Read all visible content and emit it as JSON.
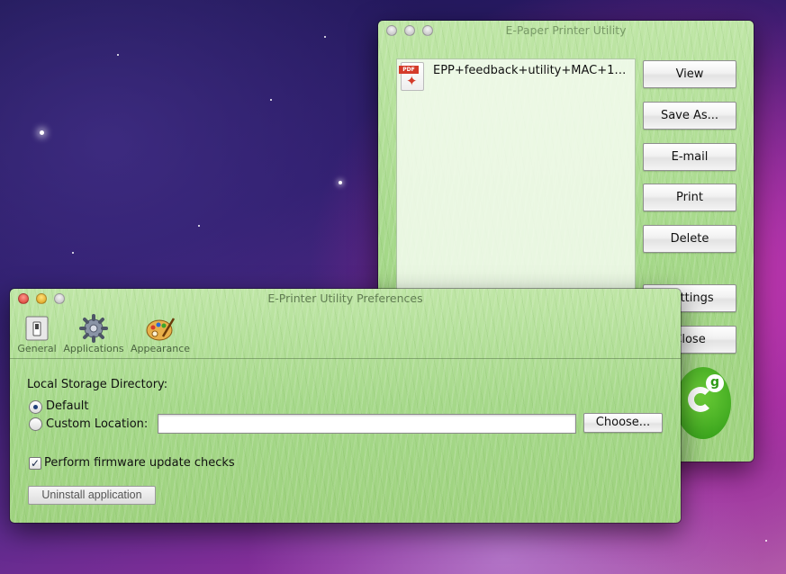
{
  "epp_window": {
    "title": "E-Paper Printer Utility",
    "files": [
      {
        "name": "EPP+feedback+utility+MAC+15...",
        "icon": "pdf-icon",
        "badge": "PDF"
      }
    ],
    "buttons": {
      "view": "View",
      "save_as": "Save As...",
      "email": "E-mail",
      "print": "Print",
      "delete": "Delete",
      "settings": "Settings",
      "close": "Close"
    },
    "logo_letter": "g"
  },
  "prefs_window": {
    "title": "E-Printer Utility Preferences",
    "toolbar": [
      {
        "label": "General",
        "icon": "switch-icon"
      },
      {
        "label": "Applications",
        "icon": "gear-icon"
      },
      {
        "label": "Appearance",
        "icon": "palette-icon"
      }
    ],
    "storage_label": "Local Storage Directory:",
    "option_default": "Default",
    "option_custom": "Custom Location:",
    "custom_location_value": "",
    "choose_button": "Choose...",
    "firmware_check_label": "Perform firmware update checks",
    "firmware_checked": true,
    "uninstall_button": "Uninstall application",
    "selected_option": "Default"
  },
  "colors": {
    "accent_red": "#d3352a",
    "logo_green": "#2e9a16"
  }
}
